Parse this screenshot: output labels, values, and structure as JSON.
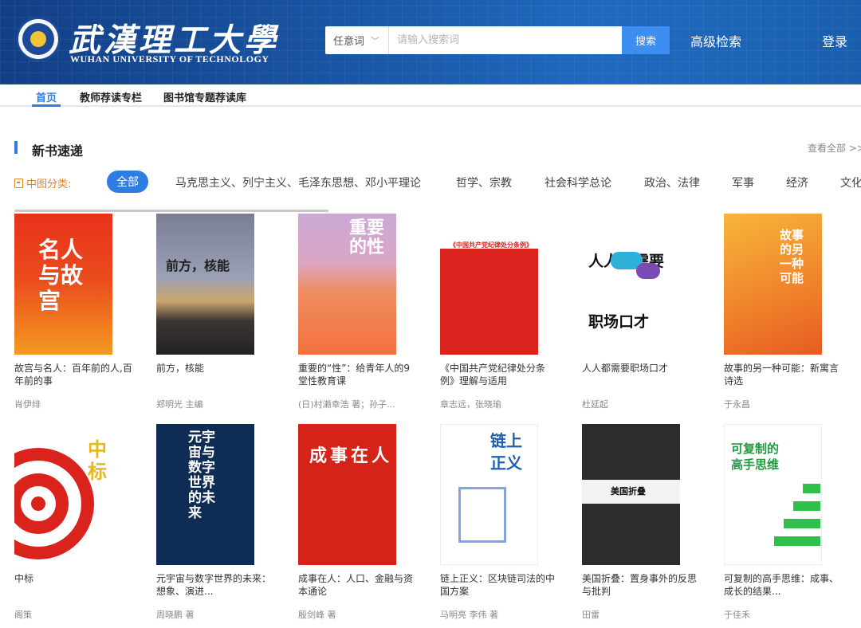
{
  "header": {
    "logo_title": "武漢理工大學",
    "logo_subtitle": "WUHAN UNIVERSITY OF TECHNOLOGY",
    "search_scope": "任意词",
    "search_placeholder": "请输入搜索词",
    "search_button": "搜索",
    "advanced_search": "高级检索",
    "login": "登录"
  },
  "nav": {
    "items": [
      "首页",
      "教师荐读专栏",
      "图书馆专题荐读库"
    ]
  },
  "section": {
    "title": "新书速递",
    "view_all": "查看全部 >>",
    "category_label": "中图分类:",
    "categories": [
      "全部",
      "马克思主义、列宁主义、毛泽东思想、邓小平理论",
      "哲学、宗教",
      "社会科学总论",
      "政治、法律",
      "军事",
      "经济",
      "文化"
    ]
  },
  "books": [
    {
      "title": "故宫与名人：百年前的人,百年前的事",
      "author": "肖伊绯",
      "cover_text": "名人与故宫"
    },
    {
      "title": "前方，核能",
      "author": "郑明光 主编",
      "cover_text": "前方，核能"
    },
    {
      "title": "重要的“性”：给青年人的9堂性教育课",
      "author": "(日)村濑幸浩 著；孙子...",
      "cover_text": "重要的性"
    },
    {
      "title": "《中国共产党纪律处分条例》理解与适用",
      "author": "章志远，张晓瑜",
      "cover_text": "《中国共产党纪律处分条例》"
    },
    {
      "title": "人人都需要职场口才",
      "author": "杜延起",
      "cover_text": "人人都需要职场口才"
    },
    {
      "title": "故事的另一种可能：新寓言诗选",
      "author": "于永昌",
      "cover_text": "故事的另一种可能"
    },
    {
      "title": "中标",
      "author": "阁策",
      "cover_text": "中标"
    },
    {
      "title": "元宇宙与数字世界的未来：想象、演进...",
      "author": "周晓鹏 著",
      "cover_text": "元宇宙与数字世界的未来"
    },
    {
      "title": "成事在人：人口、金融与资本通论",
      "author": "殷剑峰 著",
      "cover_text": "成事在人"
    },
    {
      "title": "链上正义：区块链司法的中国方案",
      "author": "马明亮 李伟 著",
      "cover_text": "链上正义"
    },
    {
      "title": "美国折叠：置身事外的反思与批判",
      "author": "田雷",
      "cover_text": "美国折叠"
    },
    {
      "title": "可复制的高手思维：成事、成长的结果...",
      "author": "于佳禾",
      "cover_text": "可复制的高手思维"
    }
  ]
}
